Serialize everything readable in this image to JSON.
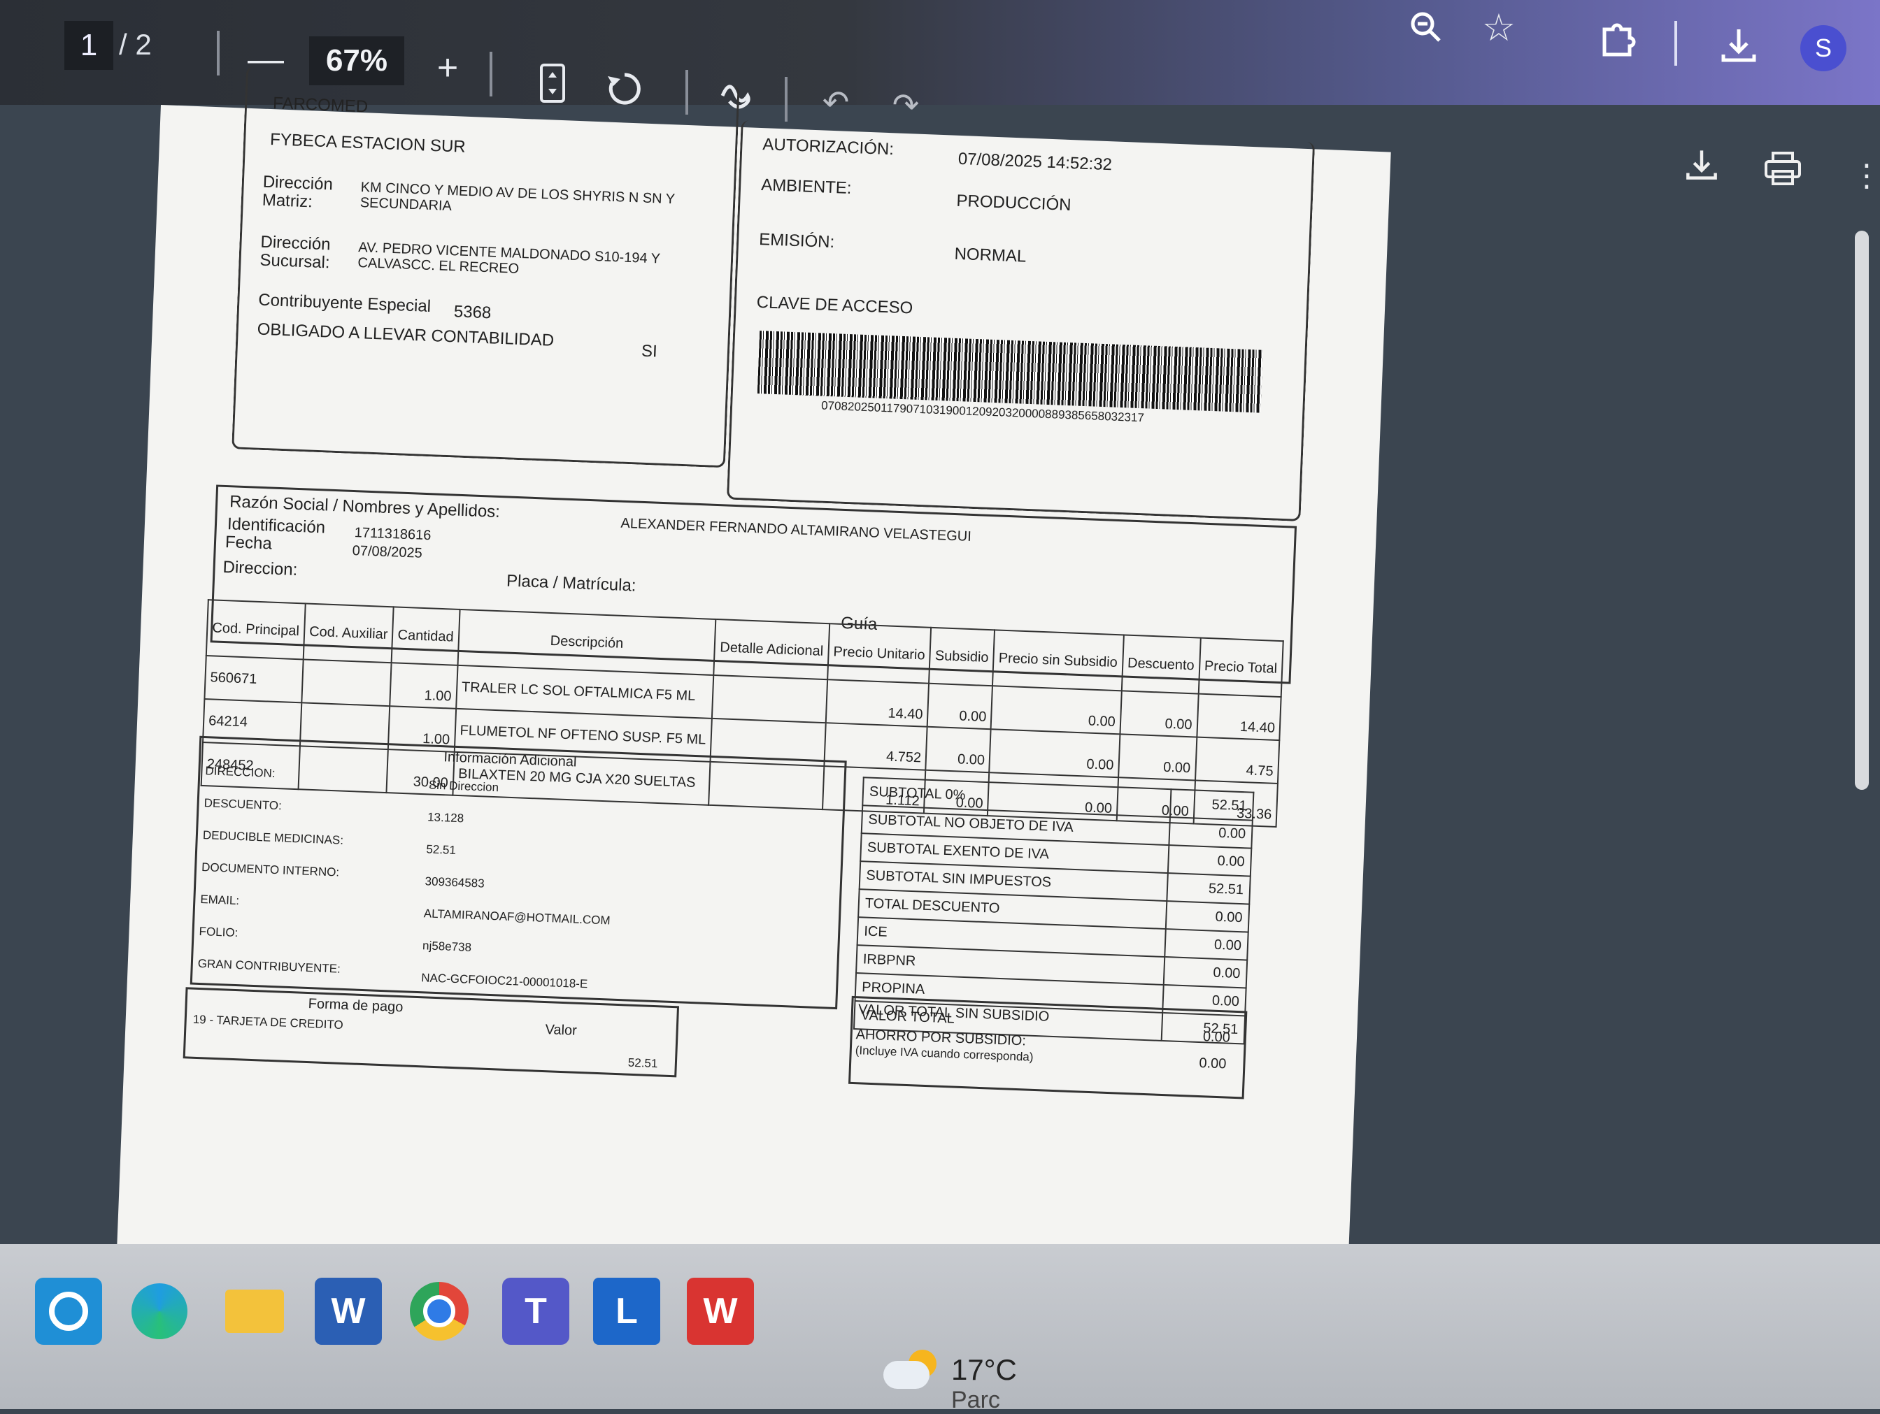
{
  "toolbar": {
    "page_current": "1",
    "page_total": "/ 2",
    "zoom": "67%",
    "zoom_out_icon": "minus-icon",
    "zoom_in_icon": "plus-icon",
    "avatar_letter": "S"
  },
  "invoice": {
    "issuer": {
      "top_cut": "FARCOMED",
      "branch_name": "FYBECA ESTACION SUR",
      "dir_matriz_label": "Dirección Matriz:",
      "dir_matriz_value": "KM CINCO Y MEDIO AV DE LOS SHYRIS N SN Y SECUNDARIA",
      "dir_sucursal_label": "Dirección Sucursal:",
      "dir_sucursal_value": "AV. PEDRO VICENTE MALDONADO S10-194 Y CALVASCC. EL RECREO",
      "contribuyente_label": "Contribuyente Especial",
      "contribuyente_value": "5368",
      "contabilidad_label": "OBLIGADO A LLEVAR CONTABILIDAD",
      "contabilidad_value": "SI"
    },
    "auth": {
      "autorizacion_label": "AUTORIZACIÓN:",
      "autorizacion_value": "07/08/2025 14:52:32",
      "ambiente_label": "AMBIENTE:",
      "ambiente_value": "PRODUCCIÓN",
      "emision_label": "EMISIÓN:",
      "emision_value": "NORMAL",
      "clave_label": "CLAVE DE ACCESO",
      "clave_number": "0708202501179071031900120920320000889385658032317"
    },
    "buyer": {
      "razon_label": "Razón Social / Nombres y Apellidos:",
      "razon_value": "ALEXANDER FERNANDO  ALTAMIRANO VELASTEGUI",
      "id_label": "Identificación",
      "id_value": "1711318616",
      "fecha_label": "Fecha",
      "fecha_value": "07/08/2025",
      "placa_label": "Placa / Matrícula:",
      "direccion_label": "Direccion:",
      "guia_label": "Guía"
    },
    "items_headers": [
      "Cod. Principal",
      "Cod. Auxiliar",
      "Cantidad",
      "Descripción",
      "Detalle Adicional",
      "Precio Unitario",
      "Subsidio",
      "Precio sin Subsidio",
      "Descuento",
      "Precio Total"
    ],
    "items": [
      {
        "cod": "560671",
        "aux": "",
        "cant": "1.00",
        "desc": "TRALER LC SOL OFTALMICA F5 ML",
        "det": "",
        "pu": "14.40",
        "sub": "0.00",
        "psub": "0.00",
        "desc2": "0.00",
        "total": "14.40"
      },
      {
        "cod": "64214",
        "aux": "",
        "cant": "1.00",
        "desc": "FLUMETOL NF OFTENO SUSP. F5 ML",
        "det": "",
        "pu": "4.752",
        "sub": "0.00",
        "psub": "0.00",
        "desc2": "0.00",
        "total": "4.75"
      },
      {
        "cod": "248452",
        "aux": "",
        "cant": "30.00",
        "desc": "BILAXTEN 20 MG CJA X20 SUELTAS",
        "det": "",
        "pu": "1.112",
        "sub": "0.00",
        "psub": "0.00",
        "desc2": "0.00",
        "total": "33.36"
      }
    ],
    "info_adicional": {
      "title": "Información Adicional",
      "rows": [
        {
          "k": "DIRECCION:",
          "v": "Sin Direccion"
        },
        {
          "k": "DESCUENTO:",
          "v": "13.128"
        },
        {
          "k": "DEDUCIBLE MEDICINAS:",
          "v": "52.51"
        },
        {
          "k": "DOCUMENTO INTERNO:",
          "v": "309364583"
        },
        {
          "k": "EMAIL:",
          "v": "ALTAMIRANOAF@HOTMAIL.COM"
        },
        {
          "k": "FOLIO:",
          "v": "nj58e738"
        },
        {
          "k": "GRAN CONTRIBUYENTE:",
          "v": "NAC-GCFOIOC21-00001018-E"
        }
      ]
    },
    "pago": {
      "forma_label": "Forma de pago",
      "valor_label": "Valor",
      "forma_value": "19 - TARJETA DE CREDITO",
      "valor_value": "52.51"
    },
    "totals": [
      {
        "k": "SUBTOTAL 0%",
        "v": "52.51"
      },
      {
        "k": "SUBTOTAL NO OBJETO DE IVA",
        "v": "0.00"
      },
      {
        "k": "SUBTOTAL EXENTO DE IVA",
        "v": "0.00"
      },
      {
        "k": "SUBTOTAL SIN IMPUESTOS",
        "v": "52.51"
      },
      {
        "k": "TOTAL DESCUENTO",
        "v": "0.00"
      },
      {
        "k": "ICE",
        "v": "0.00"
      },
      {
        "k": "IRBPNR",
        "v": "0.00"
      },
      {
        "k": "PROPINA",
        "v": "0.00"
      },
      {
        "k": "VALOR TOTAL",
        "v": "52.51"
      }
    ],
    "subsidio": {
      "valor_sin_label": "VALOR TOTAL SIN SUBSIDIO",
      "valor_sin_value": "0.00",
      "ahorro_label": "AHORRO POR SUBSIDIO:",
      "ahorro_note": "(Incluye IVA cuando corresponda)",
      "ahorro_value": "0.00"
    }
  },
  "taskbar": {
    "word_letter": "W",
    "l_letter": "L",
    "teams_letter": "T",
    "wps_letter": "W",
    "temperature": "17°C",
    "weather_cut": "Parc"
  }
}
